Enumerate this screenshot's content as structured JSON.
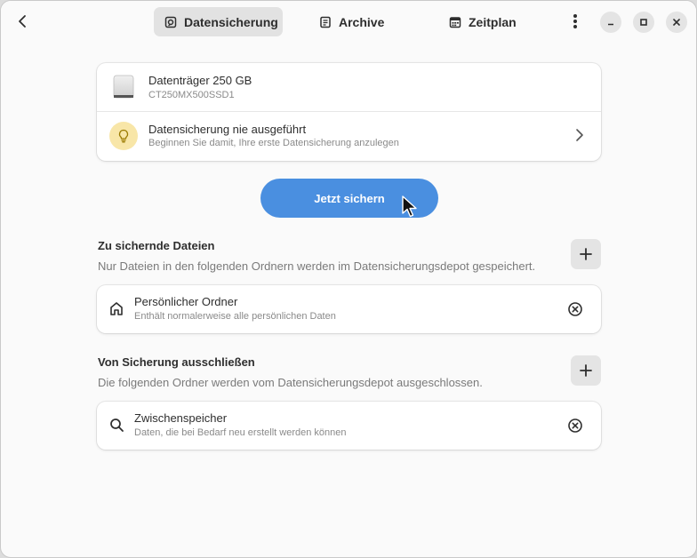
{
  "header": {
    "tabs": [
      {
        "label": "Datensicherung",
        "icon": "backup-icon",
        "active": true
      },
      {
        "label": "Archive",
        "icon": "archive-icon",
        "active": false
      },
      {
        "label": "Zeitplan",
        "icon": "calendar-icon",
        "active": false
      }
    ]
  },
  "drive": {
    "name": "Datenträger 250 GB",
    "model": "CT250MX500SSD1"
  },
  "status": {
    "title": "Datensicherung nie ausgeführt",
    "subtitle": "Beginnen Sie damit, Ihre erste Datensicherung anzulegen"
  },
  "actions": {
    "backup_now": "Jetzt sichern"
  },
  "include": {
    "title": "Zu sichernde Dateien",
    "description": "Nur Dateien in den folgenden Ordnern werden im Datensicherungsdepot gespeichert.",
    "items": [
      {
        "name": "Persönlicher Ordner",
        "detail": "Enthält normalerweise alle persönlichen Daten",
        "icon": "home-icon"
      }
    ]
  },
  "exclude": {
    "title": "Von Sicherung ausschließen",
    "description": "Die folgenden Ordner werden vom Datensicherungsdepot ausgeschlossen.",
    "items": [
      {
        "name": "Zwischenspeicher",
        "detail": "Daten, die bei Bedarf neu erstellt werden können",
        "icon": "search-icon"
      }
    ]
  },
  "colors": {
    "accent": "#4a8fe0",
    "bulb_bg": "#f8e6a8"
  }
}
